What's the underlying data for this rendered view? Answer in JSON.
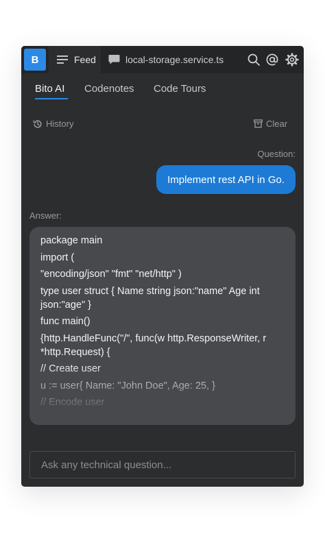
{
  "topbar": {
    "logo_letter": "B",
    "feed_label": "Feed",
    "file_label": "local-storage.service.ts"
  },
  "subtabs": [
    "Bito AI",
    "Codenotes",
    "Code Tours"
  ],
  "toolbar": {
    "history_label": "History",
    "clear_label": "Clear"
  },
  "chat": {
    "question_label": "Question:",
    "question_text": "Implement rest API in Go.",
    "answer_label": "Answer:",
    "answer_lines": [
      "package main",
      "import (",
      "\"encoding/json\" \"fmt\" \"net/http\" )",
      "type user struct { Name string json:\"name\" Age int json:\"age\" }",
      "func main()",
      "{http.HandleFunc(\"/\", func(w http.ResponseWriter, r *http.Request) {",
      "// Create user",
      "u := user{ Name: \"John Doe\", Age: 25, }",
      "// Encode user"
    ]
  },
  "input": {
    "placeholder": "Ask any technical question...",
    "value": ""
  },
  "colors": {
    "accent": "#2b8ae5",
    "question_bubble": "#1d7bd6",
    "panel_bg": "#2c2d2f",
    "answer_bg": "#47494d"
  },
  "icons": {
    "feed": "list-lines-icon",
    "file": "chat-bubble-icon",
    "search": "search-icon",
    "mention": "at-icon",
    "settings": "gear-icon",
    "history": "history-clock-icon",
    "clear": "trash-icon"
  }
}
